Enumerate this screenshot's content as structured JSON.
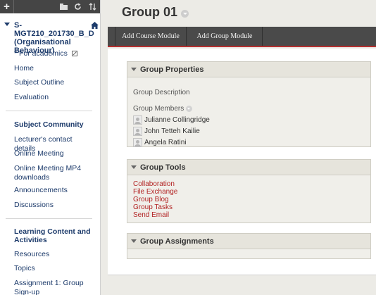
{
  "sidebar": {
    "toolbar": {
      "add_icon": "+",
      "folder_icon": "folder-icon",
      "refresh_icon": "refresh-icon",
      "sort_icon": "sort-icon"
    },
    "course_title": "S-MGT210_201730_B_D (Organisational Behaviour)",
    "items_top": [
      "* For academics",
      "Home",
      "Subject Outline",
      "Evaluation"
    ],
    "community_heading": "Subject Community",
    "community_items": [
      "Lecturer's contact details",
      "Online Meeting",
      "Online Meeting MP4 downloads",
      "Announcements",
      "Discussions"
    ],
    "learning_heading": "Learning Content and Activities",
    "learning_items": [
      "Resources",
      "Topics",
      "Assignment 1: Group Sign-up"
    ]
  },
  "page": {
    "title": "Group 01"
  },
  "action_bar": {
    "add_course_module": "Add Course Module",
    "add_group_module": "Add Group Module"
  },
  "group_properties": {
    "heading": "Group Properties",
    "description_label": "Group Description",
    "members_label": "Group Members",
    "members": [
      "Julianne Collingridge",
      "John Tetteh Kailie",
      "Angela Ratini"
    ]
  },
  "group_tools": {
    "heading": "Group Tools",
    "links": [
      "Collaboration",
      "File Exchange",
      "Group Blog",
      "Group Tasks",
      "Send Email"
    ]
  },
  "group_assignments": {
    "heading": "Group Assignments"
  },
  "colors": {
    "nav_text": "#1d3b6b",
    "tool_link": "#b22323",
    "action_bar": "#4a4a4a",
    "accent_line": "#b32e2e"
  }
}
